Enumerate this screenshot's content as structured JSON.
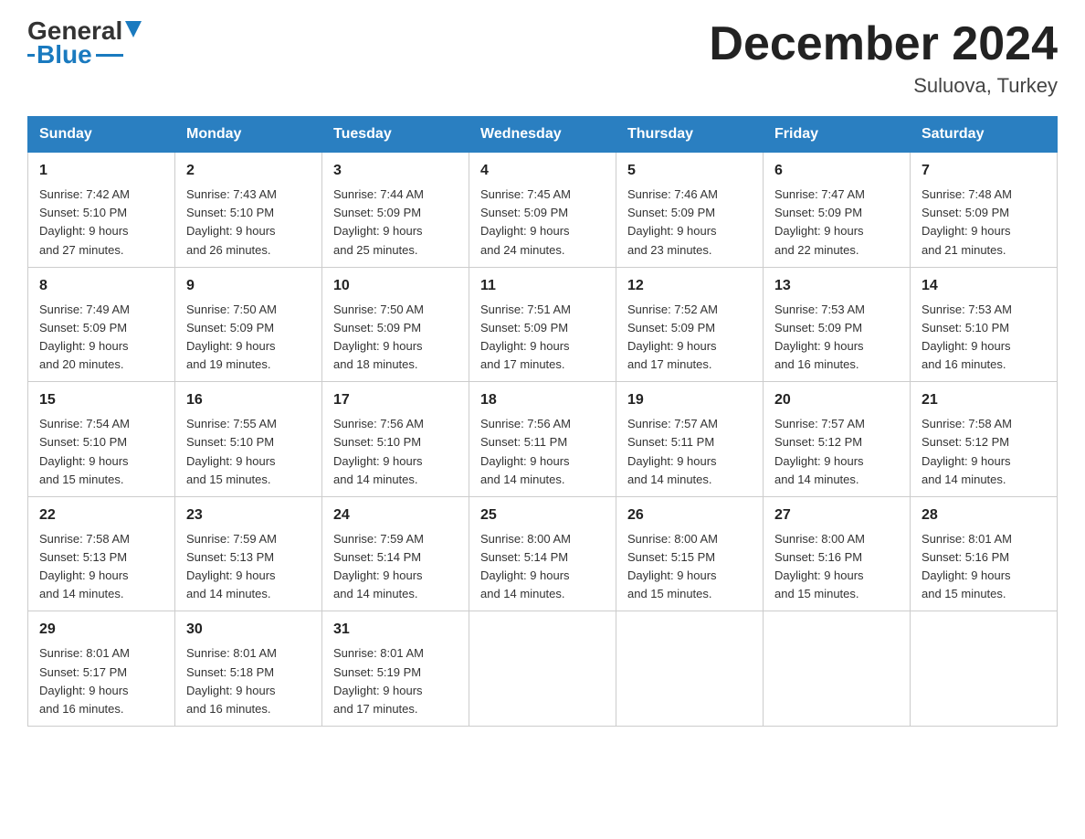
{
  "logo": {
    "general": "General",
    "blue": "Blue"
  },
  "header": {
    "month": "December 2024",
    "location": "Suluova, Turkey"
  },
  "days_of_week": [
    "Sunday",
    "Monday",
    "Tuesday",
    "Wednesday",
    "Thursday",
    "Friday",
    "Saturday"
  ],
  "weeks": [
    [
      {
        "day": "1",
        "sunrise": "7:42 AM",
        "sunset": "5:10 PM",
        "daylight": "9 hours and 27 minutes."
      },
      {
        "day": "2",
        "sunrise": "7:43 AM",
        "sunset": "5:10 PM",
        "daylight": "9 hours and 26 minutes."
      },
      {
        "day": "3",
        "sunrise": "7:44 AM",
        "sunset": "5:09 PM",
        "daylight": "9 hours and 25 minutes."
      },
      {
        "day": "4",
        "sunrise": "7:45 AM",
        "sunset": "5:09 PM",
        "daylight": "9 hours and 24 minutes."
      },
      {
        "day": "5",
        "sunrise": "7:46 AM",
        "sunset": "5:09 PM",
        "daylight": "9 hours and 23 minutes."
      },
      {
        "day": "6",
        "sunrise": "7:47 AM",
        "sunset": "5:09 PM",
        "daylight": "9 hours and 22 minutes."
      },
      {
        "day": "7",
        "sunrise": "7:48 AM",
        "sunset": "5:09 PM",
        "daylight": "9 hours and 21 minutes."
      }
    ],
    [
      {
        "day": "8",
        "sunrise": "7:49 AM",
        "sunset": "5:09 PM",
        "daylight": "9 hours and 20 minutes."
      },
      {
        "day": "9",
        "sunrise": "7:50 AM",
        "sunset": "5:09 PM",
        "daylight": "9 hours and 19 minutes."
      },
      {
        "day": "10",
        "sunrise": "7:50 AM",
        "sunset": "5:09 PM",
        "daylight": "9 hours and 18 minutes."
      },
      {
        "day": "11",
        "sunrise": "7:51 AM",
        "sunset": "5:09 PM",
        "daylight": "9 hours and 17 minutes."
      },
      {
        "day": "12",
        "sunrise": "7:52 AM",
        "sunset": "5:09 PM",
        "daylight": "9 hours and 17 minutes."
      },
      {
        "day": "13",
        "sunrise": "7:53 AM",
        "sunset": "5:09 PM",
        "daylight": "9 hours and 16 minutes."
      },
      {
        "day": "14",
        "sunrise": "7:53 AM",
        "sunset": "5:10 PM",
        "daylight": "9 hours and 16 minutes."
      }
    ],
    [
      {
        "day": "15",
        "sunrise": "7:54 AM",
        "sunset": "5:10 PM",
        "daylight": "9 hours and 15 minutes."
      },
      {
        "day": "16",
        "sunrise": "7:55 AM",
        "sunset": "5:10 PM",
        "daylight": "9 hours and 15 minutes."
      },
      {
        "day": "17",
        "sunrise": "7:56 AM",
        "sunset": "5:10 PM",
        "daylight": "9 hours and 14 minutes."
      },
      {
        "day": "18",
        "sunrise": "7:56 AM",
        "sunset": "5:11 PM",
        "daylight": "9 hours and 14 minutes."
      },
      {
        "day": "19",
        "sunrise": "7:57 AM",
        "sunset": "5:11 PM",
        "daylight": "9 hours and 14 minutes."
      },
      {
        "day": "20",
        "sunrise": "7:57 AM",
        "sunset": "5:12 PM",
        "daylight": "9 hours and 14 minutes."
      },
      {
        "day": "21",
        "sunrise": "7:58 AM",
        "sunset": "5:12 PM",
        "daylight": "9 hours and 14 minutes."
      }
    ],
    [
      {
        "day": "22",
        "sunrise": "7:58 AM",
        "sunset": "5:13 PM",
        "daylight": "9 hours and 14 minutes."
      },
      {
        "day": "23",
        "sunrise": "7:59 AM",
        "sunset": "5:13 PM",
        "daylight": "9 hours and 14 minutes."
      },
      {
        "day": "24",
        "sunrise": "7:59 AM",
        "sunset": "5:14 PM",
        "daylight": "9 hours and 14 minutes."
      },
      {
        "day": "25",
        "sunrise": "8:00 AM",
        "sunset": "5:14 PM",
        "daylight": "9 hours and 14 minutes."
      },
      {
        "day": "26",
        "sunrise": "8:00 AM",
        "sunset": "5:15 PM",
        "daylight": "9 hours and 15 minutes."
      },
      {
        "day": "27",
        "sunrise": "8:00 AM",
        "sunset": "5:16 PM",
        "daylight": "9 hours and 15 minutes."
      },
      {
        "day": "28",
        "sunrise": "8:01 AM",
        "sunset": "5:16 PM",
        "daylight": "9 hours and 15 minutes."
      }
    ],
    [
      {
        "day": "29",
        "sunrise": "8:01 AM",
        "sunset": "5:17 PM",
        "daylight": "9 hours and 16 minutes."
      },
      {
        "day": "30",
        "sunrise": "8:01 AM",
        "sunset": "5:18 PM",
        "daylight": "9 hours and 16 minutes."
      },
      {
        "day": "31",
        "sunrise": "8:01 AM",
        "sunset": "5:19 PM",
        "daylight": "9 hours and 17 minutes."
      },
      null,
      null,
      null,
      null
    ]
  ],
  "labels": {
    "sunrise": "Sunrise:",
    "sunset": "Sunset:",
    "daylight": "Daylight:"
  }
}
